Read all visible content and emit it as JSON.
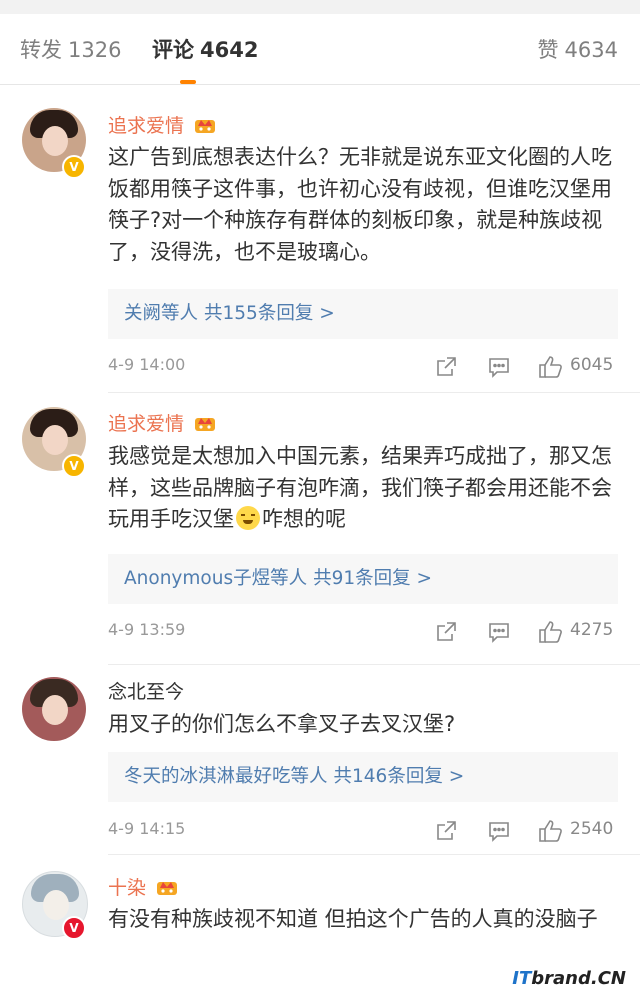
{
  "tabs": {
    "repost_label": "转发",
    "repost_count": "1326",
    "comment_label": "评论",
    "comment_count": "4642",
    "like_label": "赞",
    "like_count": "4634"
  },
  "comments": [
    {
      "username": "追求爱情",
      "text": "这广告到底想表达什么？无非就是说东亚文化圈的人吃饭都用筷子这件事，也许初心没有歧视，但谁吃汉堡用筷子?对一个种族存有群体的刻板印象，就是种族歧视了，没得洗，也不是玻璃心。",
      "reply_names": "关阙等人",
      "reply_total": "共155条回复 >",
      "time": "4-9 14:00",
      "likes": "6045"
    },
    {
      "username": "追求爱情",
      "text_before": "我感觉是太想加入中国元素，结果弄巧成拙了，那又怎样，这些品牌脑子有泡咋滴，我们筷子都会用还能不会玩用手吃汉堡",
      "text_after": "咋想的呢",
      "reply_names": "Anonymous子煜等人",
      "reply_total": "共91条回复 >",
      "time": "4-9 13:59",
      "likes": "4275"
    },
    {
      "username": "念北至今",
      "text": "用叉子的你们怎么不拿叉子去叉汉堡?",
      "reply_names": "冬天的冰淇淋最好吃等人",
      "reply_total": "共146条回复 >",
      "time": "4-9 14:15",
      "likes": "2540"
    },
    {
      "username": "十染",
      "text": "有没有种族歧视不知道 但拍这个广告的人真的没脑子"
    }
  ],
  "icons": {
    "share": "share-icon",
    "comment": "comment-icon",
    "like": "thumbs-up-icon",
    "crown": "crown-icon",
    "verified": "verified-icon"
  },
  "colors": {
    "accent": "#ff8200",
    "username": "#eb7350",
    "link": "#507daf",
    "verified_yellow": "#f7b500",
    "verified_red": "#e6162d"
  },
  "watermark": {
    "it": "IT",
    "rest": "brand.CN"
  }
}
